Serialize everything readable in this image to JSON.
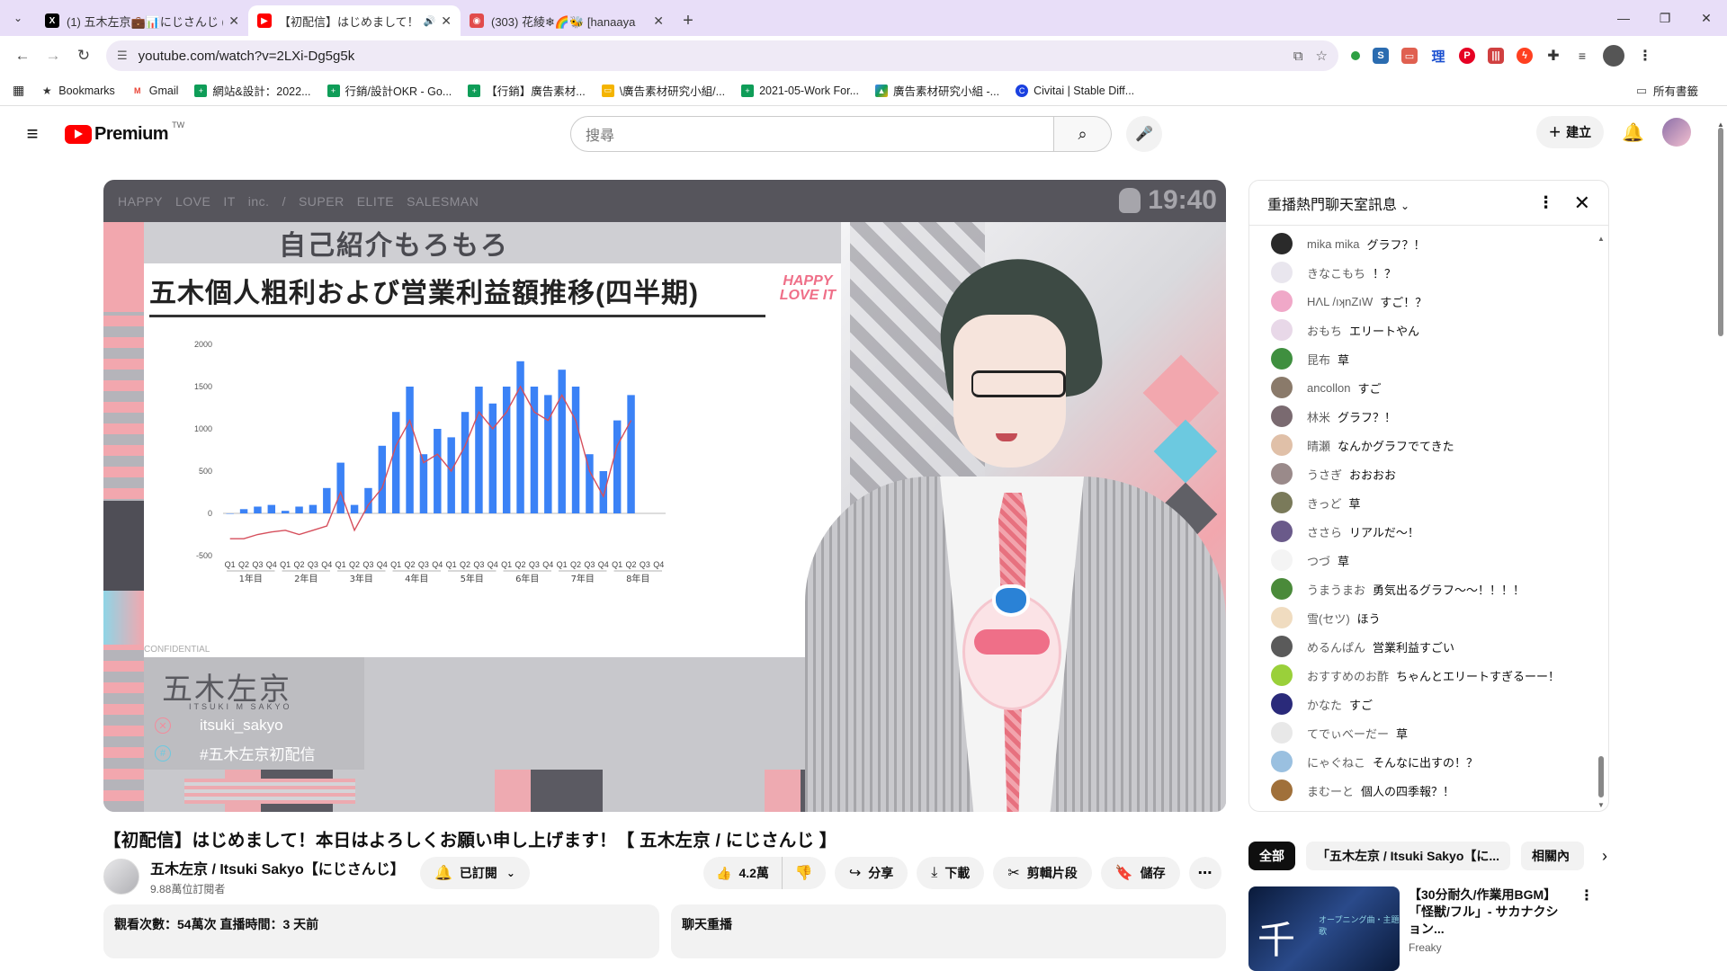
{
  "browser": {
    "tabs": [
      {
        "title": "(1) 五木左京💼📊にじさんじ (",
        "favicon": "X",
        "active": false
      },
      {
        "title": "【初配信】はじめまして！",
        "favicon": "▶",
        "active": true
      },
      {
        "title": "(303) 花綾❄🌈🐝 [hanaaya",
        "favicon": "◉",
        "active": false
      }
    ],
    "new_tab": "+",
    "url": "youtube.com/watch?v=2LXi-Dg5g5k",
    "bookmarks": [
      {
        "label": "Bookmarks"
      },
      {
        "label": "Gmail"
      },
      {
        "label": "網站&設計：2022..."
      },
      {
        "label": "行銷/設計OKR - Go..."
      },
      {
        "label": "【行銷】廣告素材..."
      },
      {
        "label": "\\廣告素材研究小組/..."
      },
      {
        "label": "2021-05-Work For..."
      },
      {
        "label": "廣告素材研究小組 -..."
      },
      {
        "label": "Civitai | Stable Diff..."
      }
    ],
    "all_bookmarks": "所有書籤"
  },
  "yt": {
    "logo": "Premium",
    "region": "TW",
    "search_placeholder": "搜尋",
    "create": "建立"
  },
  "video": {
    "overlay_words": [
      "HAPPY",
      "LOVE",
      "IT",
      "inc.",
      "/",
      "SUPER",
      "ELITE",
      "SALESMAN"
    ],
    "clock": "19:40",
    "band_title": "自己紹介もろもろ",
    "slide_title": "五木個人粗利および営業利益額推移(四半期)",
    "slide_logo_1": "HAPPY",
    "slide_logo_2": "LOVE IT",
    "confidential": "CONFIDENTIAL",
    "signature": "五木左京",
    "signature_sub": "ITSUKI M SAKYO",
    "handle": "itsuki_sakyo",
    "hashtag": "#五木左京初配信"
  },
  "chart_data": {
    "type": "bar",
    "title": "五木個人粗利および営業利益額推移(四半期)",
    "ylim": [
      -500,
      2000
    ],
    "yticks": [
      "2000",
      "1500",
      "1000",
      "500",
      "0",
      "-500"
    ],
    "quarter_labels": [
      "Q1",
      "Q2",
      "Q3",
      "Q4",
      "Q1",
      "Q2",
      "Q3",
      "Q4",
      "Q1",
      "Q2",
      "Q3",
      "Q4",
      "Q1",
      "Q2",
      "Q3",
      "Q4",
      "Q1",
      "Q2",
      "Q3",
      "Q4",
      "Q1",
      "Q2",
      "Q3",
      "Q4",
      "Q1",
      "Q2",
      "Q3",
      "Q4",
      "Q1",
      "Q2",
      "Q3",
      "Q4"
    ],
    "year_labels": [
      "1年目",
      "2年目",
      "3年目",
      "4年目",
      "5年目",
      "6年目",
      "7年目",
      "8年目"
    ],
    "series": [
      {
        "type": "bar",
        "color": "#3b82f6",
        "values": [
          0,
          50,
          80,
          100,
          30,
          80,
          100,
          300,
          600,
          100,
          300,
          800,
          1200,
          1500,
          700,
          1000,
          900,
          1200,
          1500,
          1300,
          1500,
          1800,
          1500,
          1400,
          1700,
          1500,
          700,
          500,
          1100,
          1400
        ]
      },
      {
        "type": "line",
        "color": "#d64f5c",
        "values": [
          -300,
          -300,
          -250,
          -220,
          -200,
          -250,
          -200,
          -150,
          250,
          -200,
          100,
          300,
          800,
          1100,
          600,
          700,
          500,
          800,
          1200,
          1000,
          1200,
          1500,
          1200,
          1100,
          1400,
          1100,
          500,
          200,
          800,
          1100
        ]
      }
    ]
  },
  "title": "【初配信】はじめまして！本日はよろしくお願い申し上げます！【 五木左京 / にじさんじ 】",
  "channel": {
    "name": "五木左京 / Itsuki Sakyo【にじさんじ】",
    "subs": "9.88萬位訂閱者",
    "subscribed": "已訂閱"
  },
  "actions": {
    "likes": "4.2萬",
    "share": "分享",
    "download": "下載",
    "clip": "剪輯片段",
    "save": "儲存"
  },
  "desc": {
    "views": "觀看次數：54萬次 直播時間：3 天前",
    "replay": "聊天重播"
  },
  "chat": {
    "title": "重播熱門聊天室訊息",
    "messages": [
      {
        "author": "mika mika",
        "text": "グラフ？！",
        "color": "#2a2a2a"
      },
      {
        "author": "きなこもち",
        "text": "！？",
        "color": "#e9e6ee"
      },
      {
        "author": "HɅL /ıʞnZıW",
        "text": "すご！？",
        "color": "#f0a8c8"
      },
      {
        "author": "おもち",
        "text": "エリートやん",
        "color": "#e8d8e8"
      },
      {
        "author": "昆布",
        "text": "草",
        "color": "#3f8f3f"
      },
      {
        "author": "ancollon",
        "text": "すご",
        "color": "#8a7a6a"
      },
      {
        "author": "林米",
        "text": "グラフ？！",
        "color": "#7a6a70"
      },
      {
        "author": "晴瀬",
        "text": "なんかグラフでてきた",
        "color": "#e0c0a8"
      },
      {
        "author": "うさぎ",
        "text": "おおおお",
        "color": "#9a8a8a"
      },
      {
        "author": "きっど",
        "text": "草",
        "color": "#7a7a5a"
      },
      {
        "author": "ささら",
        "text": "リアルだ〜！",
        "color": "#6a5a8a"
      },
      {
        "author": "つづ",
        "text": "草",
        "color": "#f4f4f4"
      },
      {
        "author": "うまうまお",
        "text": "勇気出るグラフ〜〜！！！！",
        "color": "#4a8a3a"
      },
      {
        "author": "雪(セツ)",
        "text": "ほう",
        "color": "#f0dcc0"
      },
      {
        "author": "めるんぱん",
        "text": "営業利益すごい",
        "color": "#5a5a5a"
      },
      {
        "author": "おすすめのお酢",
        "text": "ちゃんとエリートすぎるーー！",
        "color": "#9ad03a"
      },
      {
        "author": "かなた",
        "text": "すご",
        "color": "#2a2a7a"
      },
      {
        "author": "てでぃべーだー",
        "text": "草",
        "color": "#e8e8e8"
      },
      {
        "author": "にゃぐねこ",
        "text": "そんなに出すの！？",
        "color": "#9ac0e0"
      },
      {
        "author": "まむーと",
        "text": "個人の四季報？！",
        "color": "#a0703a"
      }
    ]
  },
  "related": {
    "chips": [
      "全部",
      "「五木左京 / Itsuki Sakyo【に...",
      "相關內"
    ],
    "video_title": "【30分耐久/作業用BGM】「怪獣/フル」- サカナクション...",
    "video_channel": "Freaky",
    "thumb_char": "千",
    "thumb_caption": "オープニング曲・主題歌"
  }
}
